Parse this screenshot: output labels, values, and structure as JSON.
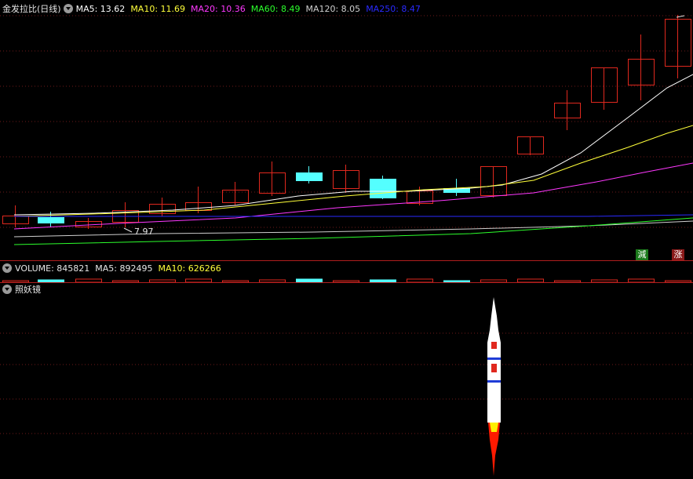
{
  "main": {
    "title": "金发拉比(日线)",
    "ma": [
      {
        "label": "MA5: 13.62",
        "color": "#ffffff"
      },
      {
        "label": "MA10: 11.69",
        "color": "#ffff3a"
      },
      {
        "label": "MA20: 10.36",
        "color": "#ff38ff"
      },
      {
        "label": "MA60: 8.49",
        "color": "#2cff2c"
      },
      {
        "label": "MA120: 8.05",
        "color": "#cfcfcf"
      },
      {
        "label": "MA250: 8.47",
        "color": "#2a2aff"
      }
    ],
    "low_marker": "7.97",
    "badge_left": "減",
    "badge_right": "涨",
    "colors": {
      "up": "#e0281e",
      "down": "#54ffff",
      "grid": "#6e1a1a",
      "sep": "#b01e1e"
    }
  },
  "volume": {
    "label": "VOLUME: 845821",
    "ma5": "MA5: 892495",
    "ma10": "MA10: 626266"
  },
  "indicator": {
    "title": "照妖镜",
    "icon": "rocket-icon"
  }
}
